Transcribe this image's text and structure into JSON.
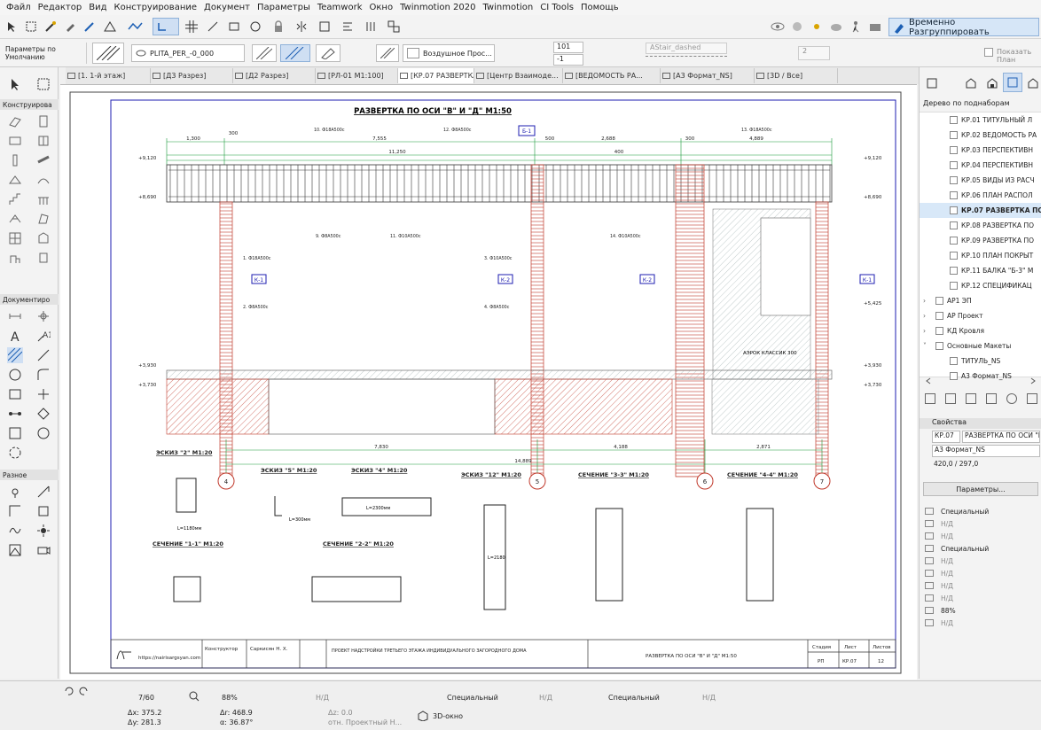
{
  "menu": [
    "Файл",
    "Редактор",
    "Вид",
    "Конструирование",
    "Документ",
    "Параметры",
    "Teamwork",
    "Окно",
    "Twinmotion 2020",
    "Twinmotion",
    "CI Tools",
    "Помощь"
  ],
  "toolbar": {
    "regroup_label": "Временно Разгруппировать"
  },
  "infobox": {
    "default_params": "Параметры по Умолчанию",
    "layer": "PLITA_PER_-0_000",
    "fill_type": "Воздушное Прос...",
    "pen1": "101",
    "pen2": "-1",
    "line_type": "AStair_dashed",
    "count": "2",
    "show_label": "Показать План"
  },
  "tabs": [
    {
      "label": "[1. 1-й этаж]"
    },
    {
      "label": "[Д3 Разрез]"
    },
    {
      "label": "[Д2 Разрез]"
    },
    {
      "label": "[РЛ-01 М1:100]"
    },
    {
      "label": "[КР.07 РАЗВЕРТКА..."
    },
    {
      "label": "[Центр Взаимоде..."
    },
    {
      "label": "[ВЕДОМОСТЬ РА..."
    },
    {
      "label": "[А3 Формат_NS]"
    },
    {
      "label": "[3D / Все]"
    }
  ],
  "left_sections": [
    "Конструирова",
    "Документиро",
    "Разное"
  ],
  "right_panel": {
    "tree_title": "Дерево по поднаборам",
    "tree_items": [
      {
        "label": "КР.01 ТИТУЛЬНЫЙ Л"
      },
      {
        "label": "КР.02 ВЕДОМОСТЬ РА"
      },
      {
        "label": "КР.03 ПЕРСПЕКТИВН"
      },
      {
        "label": "КР.04 ПЕРСПЕКТИВН"
      },
      {
        "label": "КР.05 ВИДЫ ИЗ РАСЧ"
      },
      {
        "label": "КР.06 ПЛАН РАСПОЛ"
      },
      {
        "label": "КР.07 РАЗВЕРТКА ПО"
      },
      {
        "label": "КР.08 РАЗВЕРТКА ПО"
      },
      {
        "label": "КР.09 РАЗВЕРТКА ПО"
      },
      {
        "label": "КР.10 ПЛАН ПОКРЫТ"
      },
      {
        "label": "КР.11 БАЛКА \"Б-3\" М"
      },
      {
        "label": "КР.12 СПЕЦИФИКАЦ"
      },
      {
        "label": "АР1 ЭП"
      },
      {
        "label": "АР Проект"
      },
      {
        "label": "КД Кровля"
      },
      {
        "label": "Основные Макеты"
      },
      {
        "label": "ТИТУЛЬ_NS"
      },
      {
        "label": "А3 Формат_NS"
      }
    ],
    "props_title": "Свойства",
    "prop_id": "КР.07",
    "prop_name": "РАЗВЕРТКА ПО ОСИ \"В\"",
    "prop_format": "А3 Формат_NS",
    "prop_size": "420,0 / 297,0",
    "params_button": "Параметры...",
    "pen_rows": [
      "Специальный",
      "Н/Д",
      "Н/Д",
      "Специальный",
      "Н/Д",
      "Н/Д",
      "Н/Д",
      "Н/Д",
      "88%",
      "Н/Д"
    ]
  },
  "drawing": {
    "title": "РАЗВЕРТКА ПО ОСИ \"В\" И \"Д\"  М1:50",
    "dims_top": [
      "1,300",
      "7,555",
      "2,688",
      "4,889",
      "11,250",
      "300",
      "500",
      "300",
      "400"
    ],
    "dims_bottom": [
      "7,830",
      "4,188",
      "2,871",
      "14,889"
    ],
    "levels": [
      "+9,120",
      "+8,690",
      "+3,930",
      "+3,730",
      "+5,425"
    ],
    "axes": [
      "4",
      "5",
      "6",
      "7"
    ],
    "sections": [
      "К-1",
      "К-2",
      "К-2",
      "К-1"
    ],
    "beam_label": "Б-1",
    "aerok": "АЭРОК КЛАССИК 300",
    "rebar_notes": [
      "1. Ф18А500с",
      "2. Ф8А500с",
      "3. Ф10А500с",
      "4. Ф8А500с",
      "9. Ф8А500с",
      "10. Ф18А500с",
      "11. Ф10А500с",
      "12. Ф8А500с",
      "13. Ф18А500с",
      "14. Ф10А500с"
    ],
    "sketch_titles": [
      "ЭСКИЗ \"2\" М1:20",
      "ЭСКИЗ \"5\" М1:20",
      "ЭСКИЗ \"4\" М1:20",
      "ЭСКИЗ \"12\" М1:20",
      "СЕЧЕНИЕ \"3-3\" М1:20",
      "СЕЧЕНИЕ \"4-4\" М1:20",
      "СЕЧЕНИЕ \"1-1\" М1:20",
      "СЕЧЕНИЕ \"2-2\" М1:20"
    ],
    "sketch_notes": [
      "L=1180мм",
      "L=2300мм",
      "L=300мм",
      "L=2180"
    ]
  },
  "stamp": {
    "url": "https://nairisargsyan.com",
    "role": "Конструктор",
    "person": "Саркисян Н. Х.",
    "project": "ПРОЕКТ НАДСТРОЙКИ ТРЕТЬЕГО ЭТАЖА ИНДИВИДУАЛЬНОГО ЗАГОРОДНОГО ДОМА",
    "sheet_title": "РАЗВЕРТКА ПО ОСИ \"В\" И \"Д\"  М1:50",
    "stage_h": "Стадия",
    "sheet_h": "Лист",
    "sheets_h": "Листов",
    "stage": "РП",
    "sheet": "КР.07",
    "sheets": "12"
  },
  "status": {
    "page": "7/60",
    "zoom": "88%",
    "nd1": "Н/Д",
    "special1": "Специальный",
    "nd2": "Н/Д",
    "special2": "Специальный",
    "nd3": "Н/Д",
    "dx": "Δx: 375.2",
    "dy": "Δy: 281.3",
    "dr": "Δr: 468.9",
    "da": "α: 36.87°",
    "dz": "Δz: 0.0",
    "rel": "отн. Проектный Н...",
    "view3d": "3D-окно"
  },
  "colors": {
    "accent": "#1c5fb4",
    "hatch_red": "#c0392b",
    "dim_green": "#1a9a3a",
    "note_blue": "#2233cc"
  }
}
